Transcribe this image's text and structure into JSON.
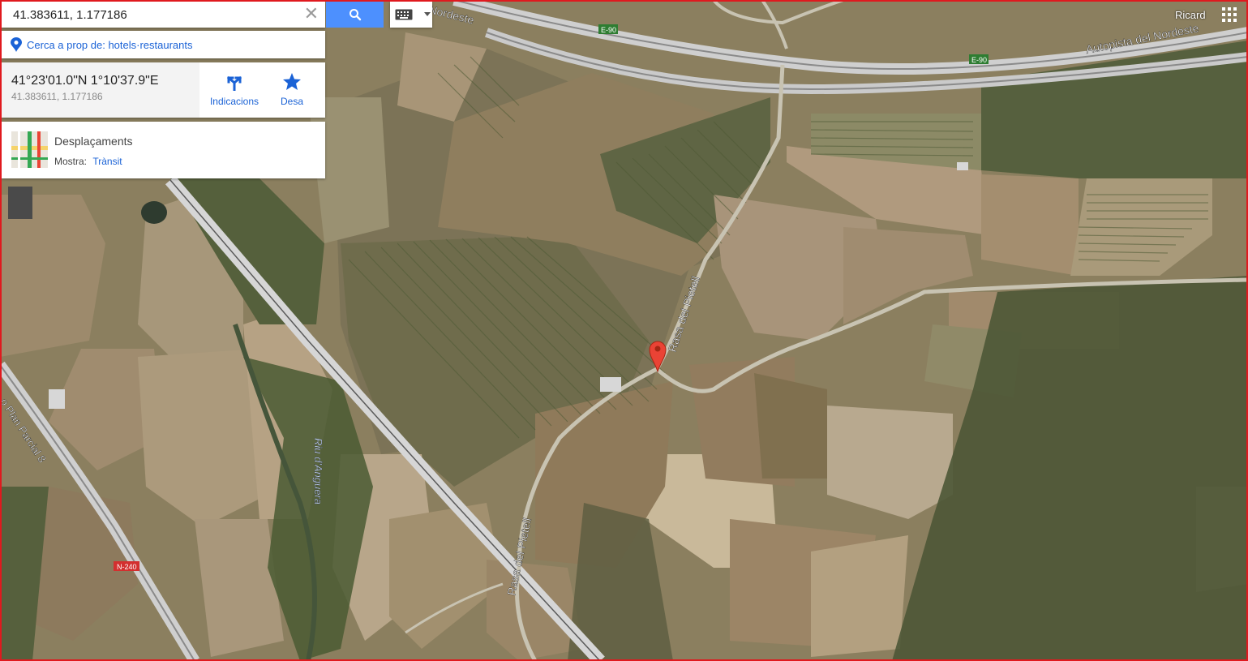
{
  "search": {
    "value": "41.383611, 1.177186"
  },
  "nearby": {
    "label": "Cerca a prop de: hotels·restaurants"
  },
  "place": {
    "dms": "41°23'01.0\"N 1°10'37.9\"E",
    "decimal": "41.383611, 1.177186",
    "directions_label": "Indicacions",
    "save_label": "Desa"
  },
  "traffic": {
    "title": "Desplaçaments",
    "show_label": "Mostra:",
    "traffic_link": "Trànsit"
  },
  "user": {
    "name": "Ricard"
  },
  "map_labels": {
    "nordeste_partial": "Nordeste",
    "highway": "Autopista del Nordeste",
    "e90_a": "E-90",
    "e90_b": "E-90",
    "rasa_upper": "Rasa del Pietell",
    "rasa_lower": "Rasa del Pietell",
    "river": "Riu d'Anguera",
    "plan_parcial": "o Plan Parcial 8",
    "n240": "N-240"
  },
  "colors": {
    "accent": "#4d90fe",
    "link": "#1a62d6",
    "marker": "#ea4335",
    "frame": "#e0191e"
  }
}
